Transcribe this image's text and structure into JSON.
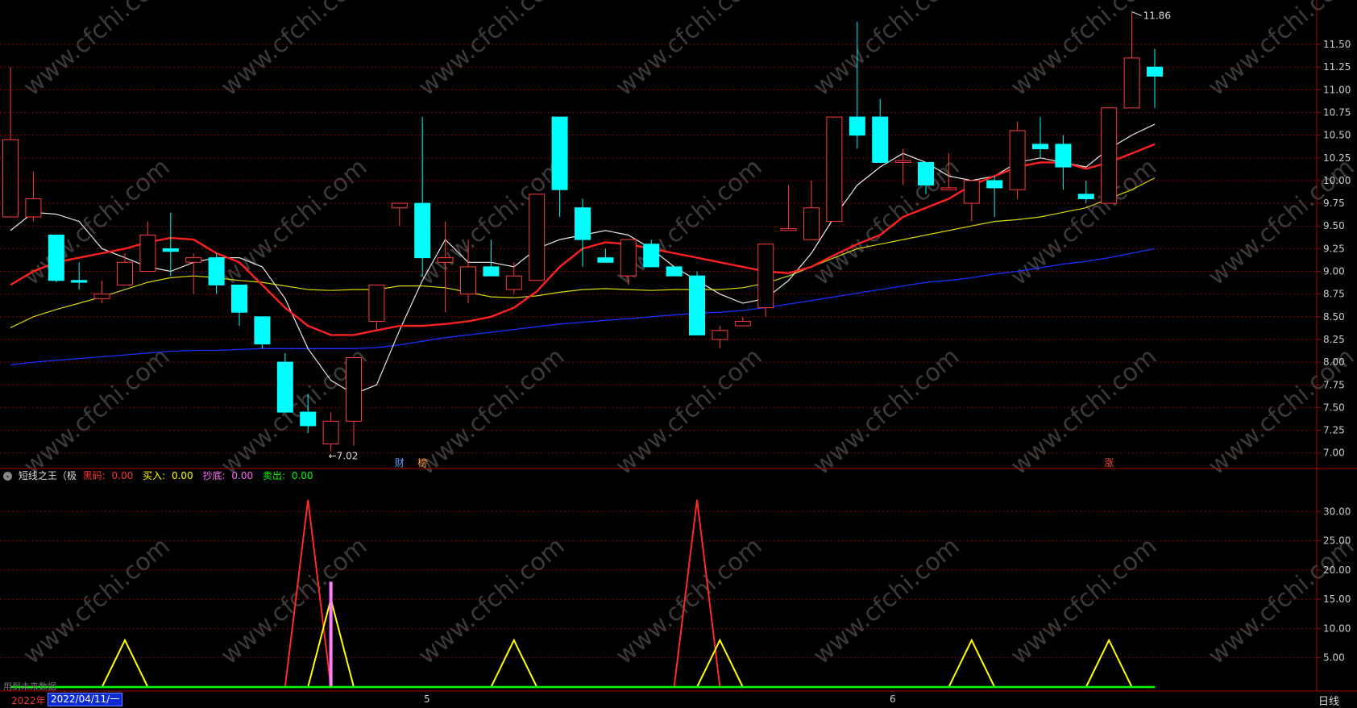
{
  "chart_data": [
    {
      "type": "candlestick",
      "x_range": [
        0,
        51
      ],
      "ylim": [
        6.9,
        11.9
      ],
      "y_ticks": [
        "7.00",
        "7.25",
        "7.50",
        "7.75",
        "8.00",
        "8.25",
        "8.50",
        "8.75",
        "9.00",
        "9.25",
        "9.50",
        "9.75",
        "10.00",
        "10.25",
        "10.50",
        "10.75",
        "11.00",
        "11.25",
        "11.50"
      ],
      "candles": [
        {
          "o": 9.6,
          "c": 10.45,
          "h": 11.25,
          "l": 9.6
        },
        {
          "o": 9.6,
          "c": 9.8,
          "h": 10.1,
          "l": 9.55
        },
        {
          "o": 9.4,
          "c": 8.9,
          "h": 9.4,
          "l": 8.88
        },
        {
          "o": 8.9,
          "c": 8.88,
          "h": 9.1,
          "l": 8.8
        },
        {
          "o": 8.7,
          "c": 8.75,
          "h": 8.9,
          "l": 8.65
        },
        {
          "o": 8.85,
          "c": 9.1,
          "h": 9.2,
          "l": 8.85
        },
        {
          "o": 9.0,
          "c": 9.4,
          "h": 9.55,
          "l": 9.0
        },
        {
          "o": 9.25,
          "c": 9.22,
          "h": 9.65,
          "l": 8.95
        },
        {
          "o": 9.1,
          "c": 9.15,
          "h": 9.2,
          "l": 8.75
        },
        {
          "o": 9.15,
          "c": 8.85,
          "h": 9.2,
          "l": 8.75
        },
        {
          "o": 8.85,
          "c": 8.55,
          "h": 8.85,
          "l": 8.4
        },
        {
          "o": 8.5,
          "c": 8.2,
          "h": 8.5,
          "l": 8.15
        },
        {
          "o": 8.0,
          "c": 7.45,
          "h": 8.1,
          "l": 7.45
        },
        {
          "o": 7.45,
          "c": 7.3,
          "h": 7.65,
          "l": 7.22
        },
        {
          "o": 7.1,
          "c": 7.35,
          "h": 7.45,
          "l": 7.02
        },
        {
          "o": 7.35,
          "c": 8.05,
          "h": 8.05,
          "l": 7.08
        },
        {
          "o": 8.45,
          "c": 8.85,
          "h": 8.85,
          "l": 8.35
        },
        {
          "o": 9.7,
          "c": 9.75,
          "h": 9.75,
          "l": 9.5
        },
        {
          "o": 9.75,
          "c": 9.15,
          "h": 10.7,
          "l": 8.95
        },
        {
          "o": 9.1,
          "c": 9.15,
          "h": 9.55,
          "l": 8.55
        },
        {
          "o": 8.75,
          "c": 9.05,
          "h": 9.35,
          "l": 8.65
        },
        {
          "o": 9.05,
          "c": 8.95,
          "h": 9.35,
          "l": 8.95
        },
        {
          "o": 8.8,
          "c": 8.95,
          "h": 9.1,
          "l": 8.75
        },
        {
          "o": 8.9,
          "c": 9.85,
          "h": 9.85,
          "l": 8.9
        },
        {
          "o": 10.7,
          "c": 9.9,
          "h": 10.7,
          "l": 9.6
        },
        {
          "o": 9.7,
          "c": 9.35,
          "h": 9.8,
          "l": 9.05
        },
        {
          "o": 9.15,
          "c": 9.1,
          "h": 9.25,
          "l": 9.1
        },
        {
          "o": 8.95,
          "c": 9.35,
          "h": 9.35,
          "l": 8.85
        },
        {
          "o": 9.3,
          "c": 9.05,
          "h": 9.35,
          "l": 9.05
        },
        {
          "o": 9.05,
          "c": 8.95,
          "h": 9.05,
          "l": 8.95
        },
        {
          "o": 8.95,
          "c": 8.3,
          "h": 9.0,
          "l": 8.3
        },
        {
          "o": 8.25,
          "c": 8.35,
          "h": 8.4,
          "l": 8.15
        },
        {
          "o": 8.4,
          "c": 8.45,
          "h": 8.5,
          "l": 8.4
        },
        {
          "o": 8.6,
          "c": 9.3,
          "h": 9.3,
          "l": 8.5
        },
        {
          "o": 9.45,
          "c": 9.47,
          "h": 9.95,
          "l": 9.45
        },
        {
          "o": 9.35,
          "c": 9.7,
          "h": 10.0,
          "l": 9.35
        },
        {
          "o": 9.55,
          "c": 10.7,
          "h": 10.7,
          "l": 9.55
        },
        {
          "o": 10.7,
          "c": 10.5,
          "h": 11.75,
          "l": 10.35
        },
        {
          "o": 10.7,
          "c": 10.2,
          "h": 10.9,
          "l": 10.2
        },
        {
          "o": 10.2,
          "c": 10.22,
          "h": 10.35,
          "l": 9.95
        },
        {
          "o": 10.2,
          "c": 9.95,
          "h": 10.2,
          "l": 9.85
        },
        {
          "o": 9.9,
          "c": 9.92,
          "h": 10.3,
          "l": 9.9
        },
        {
          "o": 9.75,
          "c": 10.0,
          "h": 10.0,
          "l": 9.55
        },
        {
          "o": 10.0,
          "c": 9.92,
          "h": 10.05,
          "l": 9.6
        },
        {
          "o": 9.9,
          "c": 10.55,
          "h": 10.65,
          "l": 9.8
        },
        {
          "o": 10.4,
          "c": 10.35,
          "h": 10.7,
          "l": 10.25
        },
        {
          "o": 10.4,
          "c": 10.15,
          "h": 10.5,
          "l": 9.9
        },
        {
          "o": 9.85,
          "c": 9.8,
          "h": 10.0,
          "l": 9.75
        },
        {
          "o": 9.75,
          "c": 10.8,
          "h": 10.8,
          "l": 9.75
        },
        {
          "o": 10.8,
          "c": 11.35,
          "h": 11.86,
          "l": 10.8
        },
        {
          "o": 11.25,
          "c": 11.15,
          "h": 11.45,
          "l": 10.8
        }
      ],
      "ma_white": [
        9.45,
        9.65,
        9.63,
        9.55,
        9.25,
        9.15,
        9.05,
        9.0,
        9.1,
        9.15,
        9.15,
        9.05,
        8.7,
        8.15,
        7.8,
        7.65,
        7.75,
        8.35,
        8.9,
        9.35,
        9.1,
        9.1,
        9.05,
        9.25,
        9.35,
        9.4,
        9.45,
        9.4,
        9.25,
        9.05,
        8.9,
        8.75,
        8.65,
        8.7,
        8.9,
        9.2,
        9.6,
        9.95,
        10.15,
        10.3,
        10.2,
        10.05,
        10.0,
        10.05,
        10.2,
        10.25,
        10.2,
        10.15,
        10.35,
        10.5,
        10.62
      ],
      "ma_red": [
        8.85,
        9.0,
        9.1,
        9.15,
        9.2,
        9.25,
        9.32,
        9.37,
        9.35,
        9.2,
        9.1,
        8.85,
        8.6,
        8.4,
        8.3,
        8.3,
        8.35,
        8.4,
        8.4,
        8.42,
        8.45,
        8.5,
        8.6,
        8.78,
        9.05,
        9.25,
        9.32,
        9.3,
        9.25,
        9.2,
        9.15,
        9.1,
        9.05,
        9.0,
        8.98,
        9.05,
        9.18,
        9.3,
        9.4,
        9.6,
        9.7,
        9.8,
        9.95,
        10.05,
        10.15,
        10.2,
        10.2,
        10.13,
        10.2,
        10.3,
        10.4
      ],
      "ma_yellow": [
        8.38,
        8.5,
        8.58,
        8.65,
        8.72,
        8.8,
        8.88,
        8.93,
        8.95,
        8.93,
        8.9,
        8.88,
        8.84,
        8.8,
        8.79,
        8.8,
        8.8,
        8.84,
        8.84,
        8.82,
        8.77,
        8.72,
        8.71,
        8.73,
        8.77,
        8.8,
        8.81,
        8.8,
        8.79,
        8.8,
        8.8,
        8.8,
        8.82,
        8.87,
        8.95,
        9.05,
        9.15,
        9.25,
        9.3,
        9.35,
        9.4,
        9.45,
        9.5,
        9.55,
        9.57,
        9.6,
        9.65,
        9.7,
        9.8,
        9.9,
        10.03
      ],
      "ma_blue": [
        7.97,
        8.0,
        8.02,
        8.04,
        8.06,
        8.08,
        8.1,
        8.12,
        8.13,
        8.13,
        8.14,
        8.15,
        8.15,
        8.15,
        8.15,
        8.15,
        8.16,
        8.19,
        8.23,
        8.27,
        8.3,
        8.33,
        8.36,
        8.39,
        8.42,
        8.44,
        8.46,
        8.48,
        8.5,
        8.52,
        8.54,
        8.55,
        8.57,
        8.6,
        8.64,
        8.68,
        8.72,
        8.76,
        8.8,
        8.84,
        8.88,
        8.9,
        8.93,
        8.97,
        9.0,
        9.04,
        9.08,
        9.11,
        9.15,
        9.2,
        9.25
      ],
      "annotations": [
        {
          "label": "11.86",
          "index": 49,
          "value": 11.86
        },
        {
          "label": "←7.02",
          "index": 14,
          "value": 7.02
        }
      ],
      "markers": [
        {
          "label": "财",
          "index": 17,
          "color": "#5aa0ff"
        },
        {
          "label": "榜",
          "index": 18,
          "color": "#ff9a3a"
        },
        {
          "label": "涨",
          "index": 48,
          "color": "#ff4444"
        }
      ]
    },
    {
      "type": "line",
      "title": "短线之王（极",
      "ylim": [
        0,
        35
      ],
      "y_ticks": [
        "5.00",
        "10.00",
        "15.00",
        "20.00",
        "25.00",
        "30.00"
      ],
      "series": [
        {
          "name": "黑码",
          "color": "#ff2a2a",
          "points": [
            [
              12,
              0
            ],
            [
              13,
              32
            ],
            [
              14,
              0
            ],
            [
              29,
              0
            ],
            [
              30,
              32
            ],
            [
              31,
              0
            ]
          ]
        },
        {
          "name": "买入",
          "color": "#ffff00",
          "points": [
            [
              4,
              0
            ],
            [
              5,
              8
            ],
            [
              6,
              0
            ],
            [
              13,
              0
            ],
            [
              14,
              15
            ],
            [
              15,
              0
            ],
            [
              21,
              0
            ],
            [
              22,
              8
            ],
            [
              23,
              0
            ],
            [
              30,
              0
            ],
            [
              31,
              8
            ],
            [
              32,
              0
            ],
            [
              41,
              0
            ],
            [
              42,
              8
            ],
            [
              43,
              0
            ],
            [
              47,
              0
            ],
            [
              48,
              8
            ],
            [
              49,
              0
            ]
          ]
        },
        {
          "name": "抄底",
          "color": "#ff80ff",
          "bar": {
            "index": 14,
            "value": 18
          }
        },
        {
          "name": "卖出",
          "color": "#00ff00",
          "baseline": 0
        }
      ]
    }
  ],
  "indicator_header": {
    "title": "短线之王（极",
    "items": [
      {
        "name": "黑码:",
        "value": "0.00",
        "color": "#ff3333"
      },
      {
        "name": "买入:",
        "value": "0.00",
        "color": "#ffff00"
      },
      {
        "name": "抄底:",
        "value": "0.00",
        "color": "#ff66ff"
      },
      {
        "name": "卖出:",
        "value": "0.00",
        "color": "#00ff00"
      }
    ]
  },
  "watermark": "www.cfchi.com",
  "bottom_bar": {
    "year": "2022年",
    "date": "2022/04/11/一",
    "month_5": "5",
    "month_6": "6",
    "period": "日线"
  },
  "footer_note": "用到未来数据",
  "colors": {
    "up": "#ff3b3b",
    "down": "#00ffff",
    "grid": "#8b0000",
    "axis_text": "#cccccc",
    "ma_white": "#e8e8e8",
    "ma_red": "#ff2020",
    "ma_yellow": "#d8d800",
    "ma_blue": "#1a2fff"
  }
}
